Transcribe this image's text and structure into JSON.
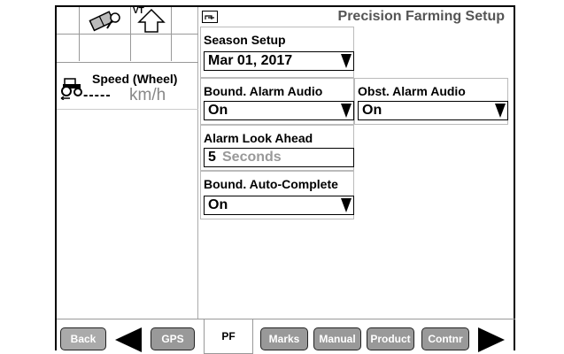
{
  "header": {
    "title": "Precision Farming Setup",
    "icons": [
      "book-icon",
      "search-icon",
      "vt-icon",
      "up-arrow-icon",
      "title-menu-icon"
    ],
    "vt_label": "VT"
  },
  "speed": {
    "title": "Speed (Wheel)",
    "value": "-----",
    "unit": "km/h"
  },
  "season": {
    "label": "Season Setup",
    "value": "Mar 01, 2017"
  },
  "bound_alarm": {
    "label": "Bound. Alarm Audio",
    "value": "On"
  },
  "obst_alarm": {
    "label": "Obst. Alarm Audio",
    "value": "On"
  },
  "look_ahead": {
    "label": "Alarm Look Ahead",
    "number": "5",
    "unit": "Seconds"
  },
  "auto_complete": {
    "label": "Bound. Auto-Complete",
    "value": "On"
  },
  "tabs": {
    "back": "Back",
    "gps": "GPS",
    "pf": "PF",
    "marks": "Marks",
    "manual": "Manual",
    "product": "Product",
    "contnr": "Contnr"
  }
}
